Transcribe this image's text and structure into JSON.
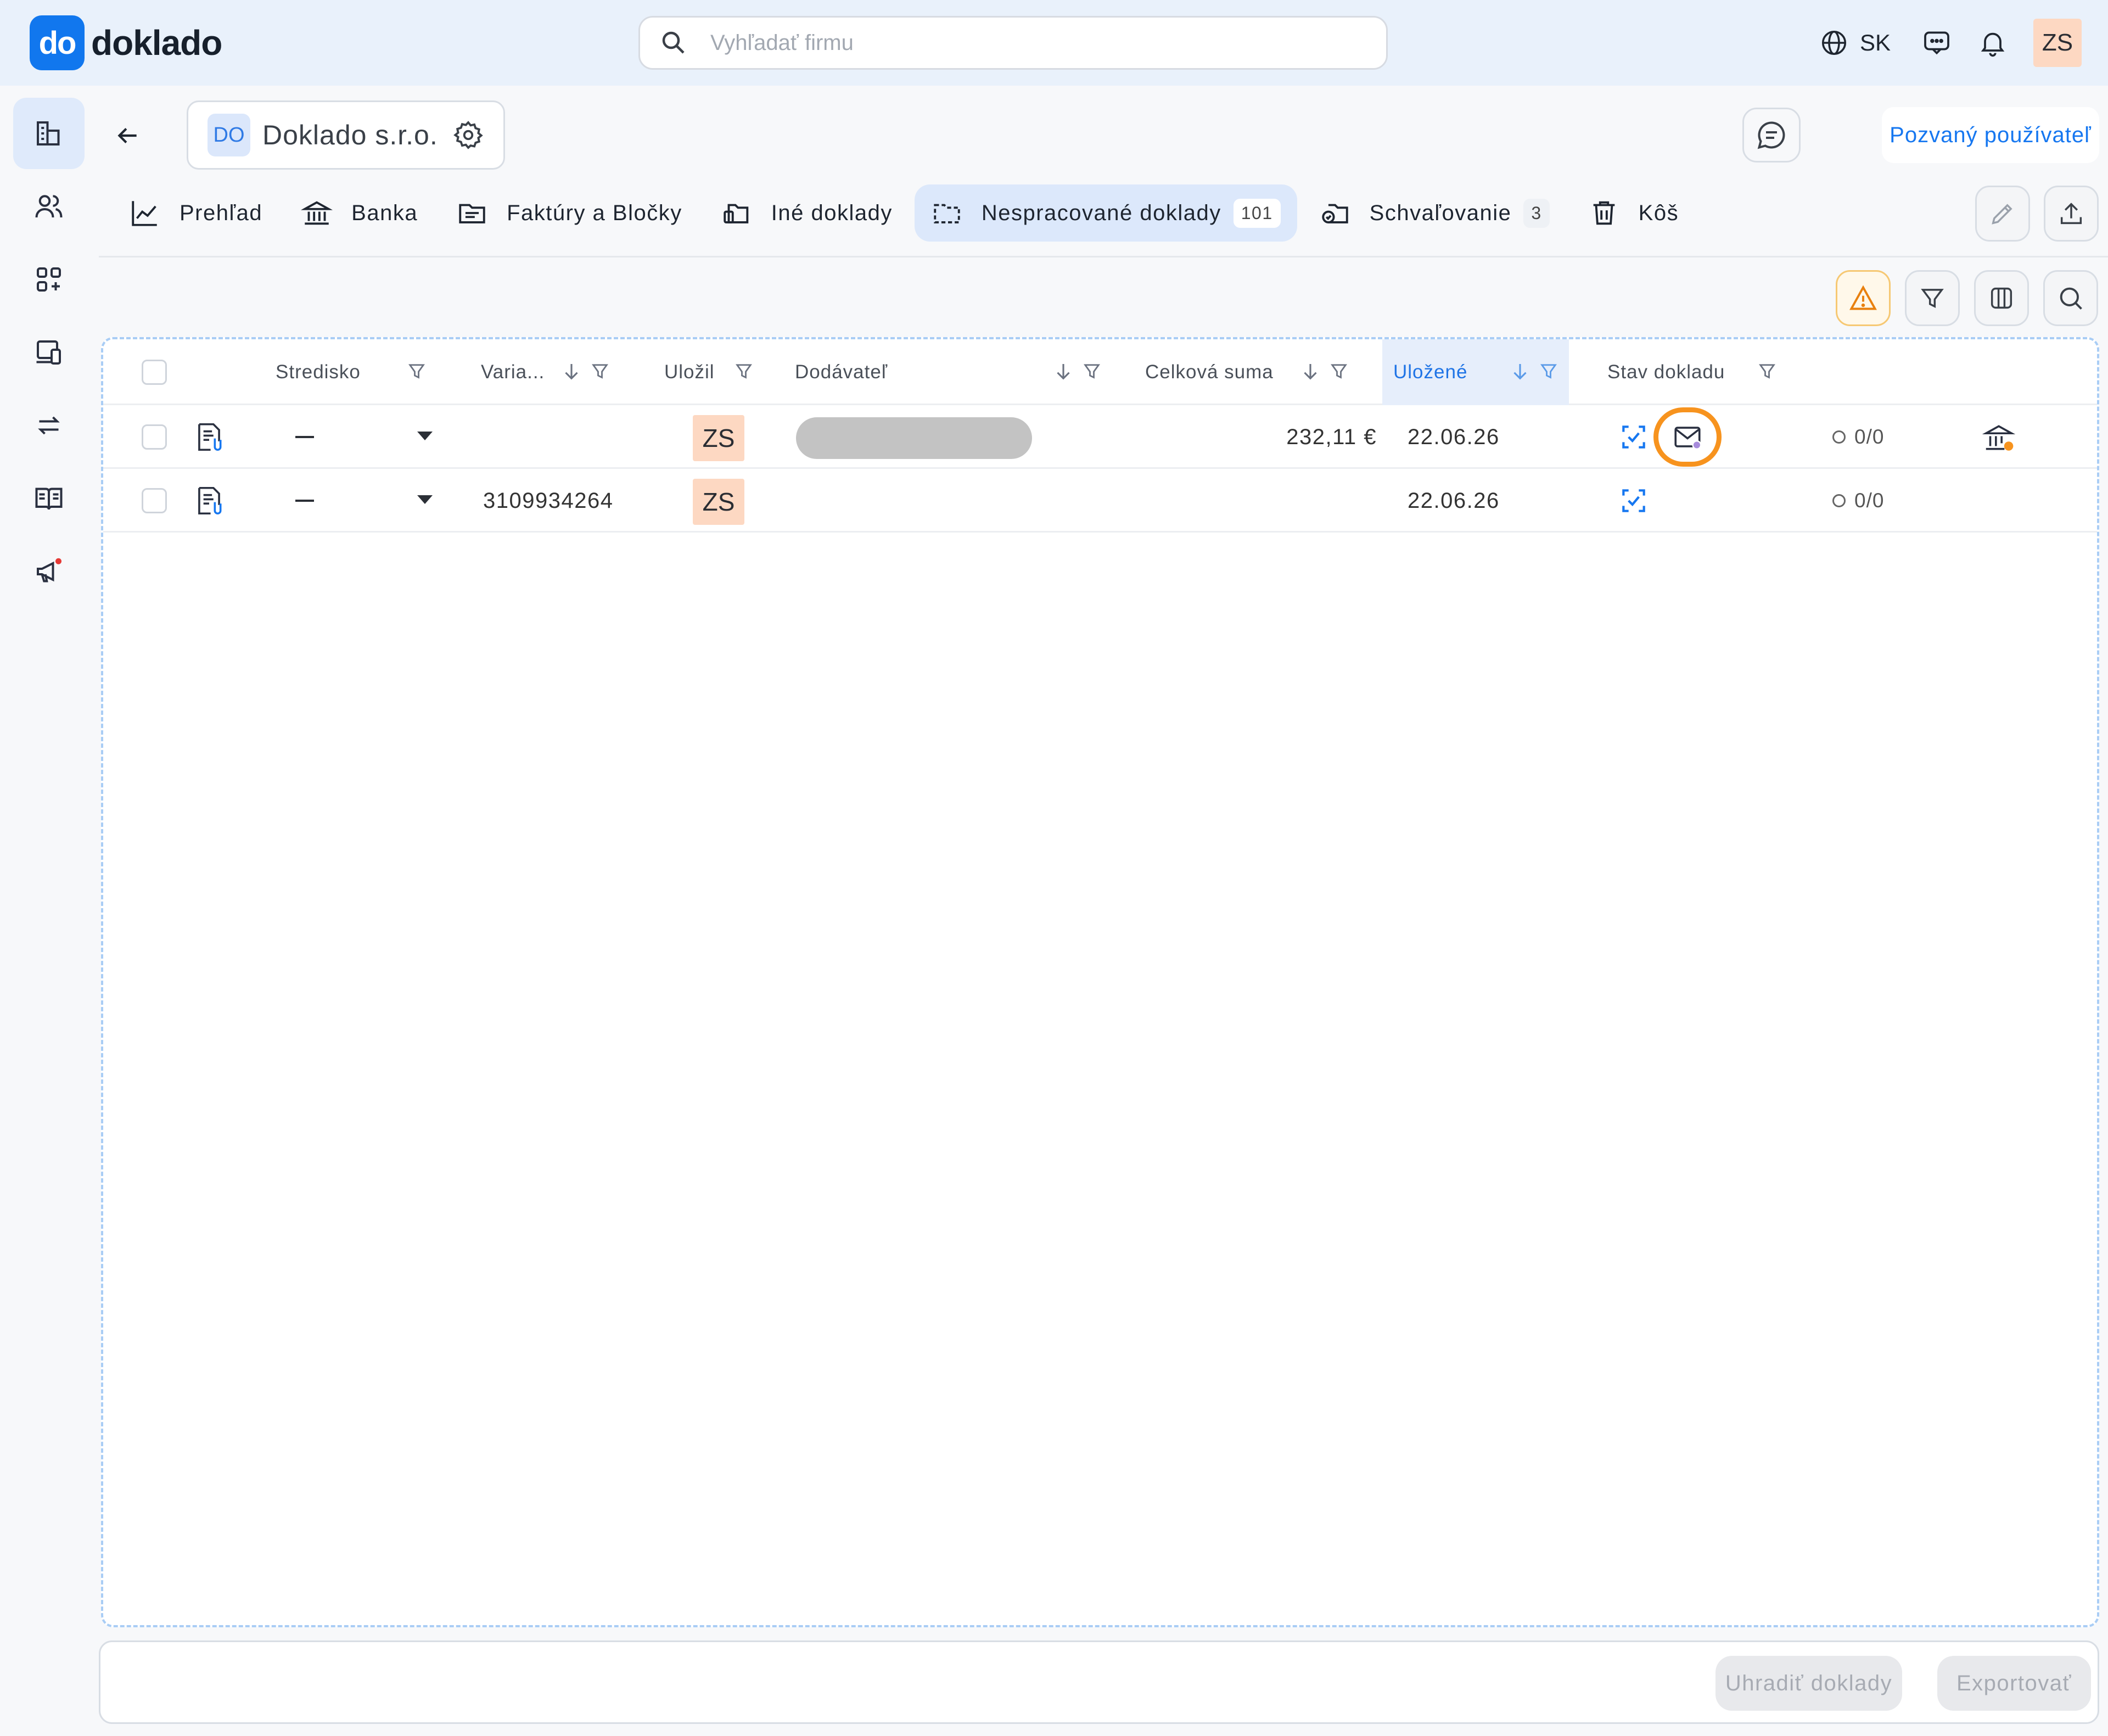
{
  "app": {
    "logo_mark": "do",
    "logo_word": "doklado",
    "brand_color": "#1177ee"
  },
  "search": {
    "placeholder": "Vyhľadať firmu"
  },
  "topbar": {
    "language": "SK",
    "user_initials": "ZS",
    "icons": [
      "globe-icon",
      "chat-icon",
      "bell-icon"
    ]
  },
  "rail": {
    "items": [
      "building-icon",
      "users-icon",
      "apps-icon",
      "devices-icon",
      "transfer-icon",
      "book-icon",
      "megaphone-icon"
    ],
    "active": "building-icon"
  },
  "company": {
    "badge": "DO",
    "name": "Doklado s.r.o."
  },
  "header": {
    "invite_label": "Pozvaný používateľ"
  },
  "tabs": [
    {
      "label": "Prehľad",
      "icon": "chart-line-icon"
    },
    {
      "label": "Banka",
      "icon": "bank-icon"
    },
    {
      "label": "Faktúry a Bločky",
      "icon": "invoice-icon"
    },
    {
      "label": "Iné doklady",
      "icon": "documents-icon"
    },
    {
      "label": "Nespracované doklady",
      "icon": "folder-dashed-icon",
      "count": "101",
      "active": true
    },
    {
      "label": "Schvaľovanie",
      "icon": "approval-icon",
      "count": "3"
    },
    {
      "label": "Kôš",
      "icon": "trash-icon"
    }
  ],
  "table": {
    "columns": {
      "stredisko": "Stredisko",
      "varia": "Varia...",
      "ulozil": "Uložil",
      "dodavatel": "Dodávateľ",
      "suma": "Celková suma",
      "ulozene": "Uložené",
      "stav": "Stav dokladu"
    },
    "sorted_column": "Uložené",
    "rows": [
      {
        "stredisko": "—",
        "variabilny": "",
        "ulozil": "ZS",
        "dodavatel": "",
        "suma": "232,11 €",
        "ulozene": "22.06.26",
        "payments": "0/0",
        "highlighted_mail": true
      },
      {
        "stredisko": "—",
        "variabilny": "3109934264",
        "ulozil": "ZS",
        "dodavatel": "",
        "suma": "",
        "ulozene": "22.06.26",
        "payments": "0/0",
        "highlighted_mail": false
      }
    ]
  },
  "footer": {
    "pay_label": "Uhradiť doklady",
    "export_label": "Exportovať"
  },
  "colors": {
    "accent": "#1677f0",
    "warning": "#f7931e",
    "avatar_bg": "#fdd8c2"
  }
}
